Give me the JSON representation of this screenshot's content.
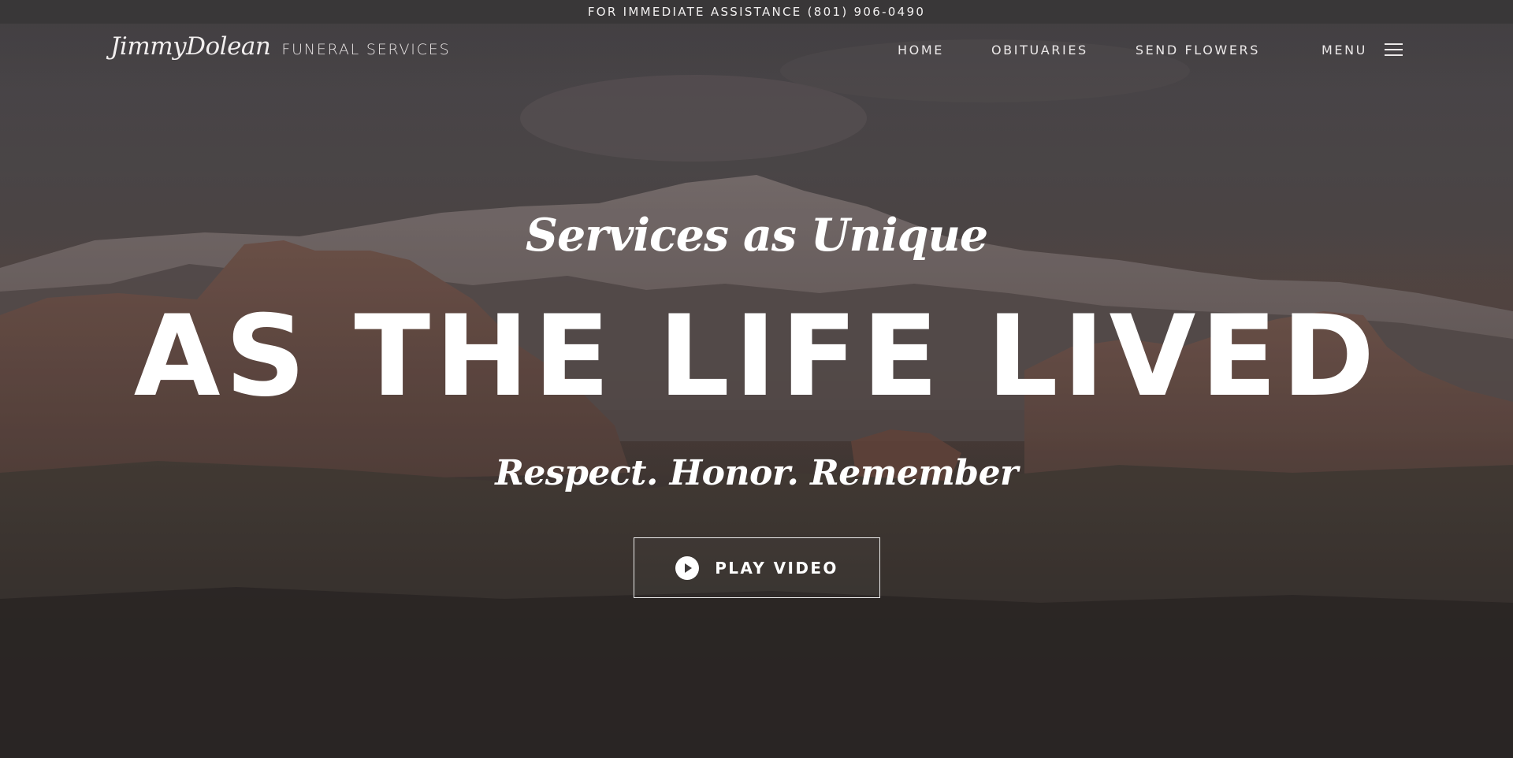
{
  "topbar": {
    "text": "FOR IMMEDIATE ASSISTANCE (801) 906-0490"
  },
  "header": {
    "logo_script": "JimmyDolean",
    "logo_caption": "FUNERAL SERVICES",
    "nav": [
      {
        "label": "HOME"
      },
      {
        "label": "OBITUARIES"
      },
      {
        "label": "SEND FLOWERS"
      }
    ],
    "menu_label": "MENU"
  },
  "hero": {
    "kicker": "Services as Unique",
    "title": "AS THE LIFE LIVED",
    "tagline": "Respect. Honor. Remember",
    "play_label": "PLAY VIDEO"
  },
  "icons": {
    "menu": "hamburger-icon",
    "play": "play-icon"
  },
  "colors": {
    "topbar_bg": "#393738",
    "text": "#ffffff"
  }
}
